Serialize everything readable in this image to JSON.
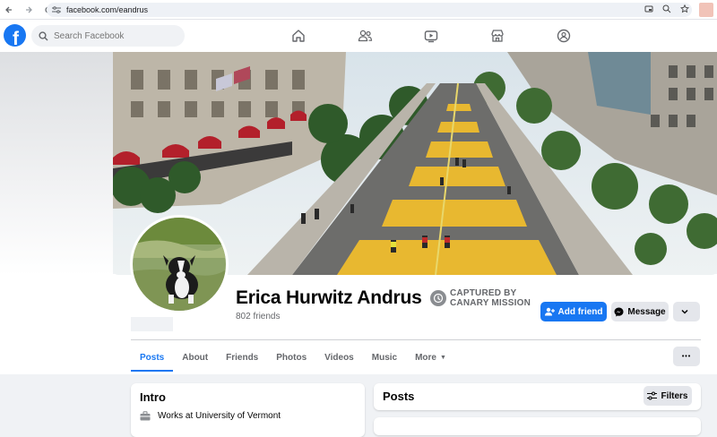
{
  "browser": {
    "url": "facebook.com/eandrus",
    "icons": [
      "back-icon",
      "forward-icon",
      "reload-icon",
      "site-settings-icon",
      "cast-icon",
      "zoom-icon",
      "bookmark-star-icon"
    ]
  },
  "topbar": {
    "logo_letter": "f",
    "search_placeholder": "Search Facebook",
    "nav_icons": [
      "home-icon",
      "friends-icon",
      "watch-icon",
      "marketplace-icon",
      "groups-icon"
    ]
  },
  "profile": {
    "name": "Erica Hurwitz Andrus",
    "friends": "802 friends",
    "badge_line1": "CAPTURED BY",
    "badge_line2": "CANARY MISSION",
    "add_friend": "Add friend",
    "message": "Message"
  },
  "tabs": [
    {
      "label": "Posts",
      "active": true
    },
    {
      "label": "About",
      "active": false
    },
    {
      "label": "Friends",
      "active": false
    },
    {
      "label": "Photos",
      "active": false
    },
    {
      "label": "Videos",
      "active": false
    },
    {
      "label": "Music",
      "active": false
    },
    {
      "label": "More",
      "active": false
    }
  ],
  "more_dots": "•••",
  "intro": {
    "title": "Intro",
    "work": "Works at University of Vermont"
  },
  "posts": {
    "title": "Posts",
    "filters": "Filters"
  },
  "colors": {
    "brand_blue": "#1877f2",
    "page_bg": "#f0f2f5",
    "secondary_text": "#65676b",
    "button_gray": "#e4e6eb"
  }
}
